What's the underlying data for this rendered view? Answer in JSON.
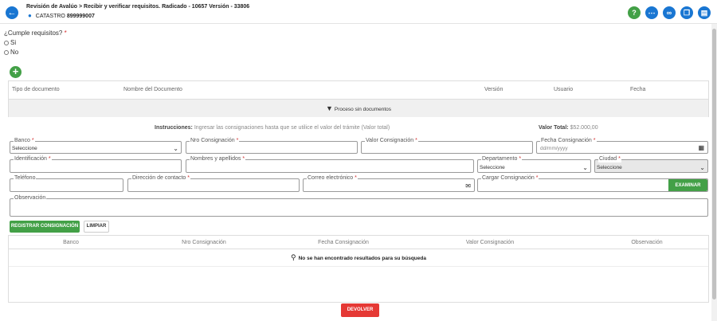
{
  "header": {
    "breadcrumb": "Revisión de Avalúo  >  Recibir y verificar requisitos. Radicado - 10657 Versión - 33806",
    "catastro_label": "CATASTRO",
    "catastro_value": "899999007"
  },
  "requisitos": {
    "question": "¿Cumple requisitos?",
    "options": [
      "Si",
      "No"
    ]
  },
  "doc_table": {
    "columns": [
      "Tipo de documento",
      "Nombre del Documento",
      "Versión",
      "Usuario",
      "Fecha"
    ],
    "empty_message": "Proceso sin documentos"
  },
  "instructions": {
    "label": "Instrucciones:",
    "text": "Ingresar las consignaciones hasta que se utilice el valor del trámite (Valor total)"
  },
  "valor_total": {
    "label": "Valor Total:",
    "value": "$52.000,00"
  },
  "form": {
    "banco": {
      "label": "Banco",
      "value": "Seleccione"
    },
    "nro_consignacion": {
      "label": "Nro Consignación",
      "value": ""
    },
    "valor_consignacion": {
      "label": "Valor Consignación",
      "value": ""
    },
    "fecha_consignacion": {
      "label": "Fecha Consignación",
      "placeholder": "dd/mm/yyyy"
    },
    "identificacion": {
      "label": "Identificación",
      "value": ""
    },
    "nombres": {
      "label": "Nombres y apellidos",
      "value": ""
    },
    "departamento": {
      "label": "Departamento",
      "value": "Seleccione"
    },
    "ciudad": {
      "label": "Ciudad",
      "value": "Seleccione"
    },
    "telefono": {
      "label": "Teléfono",
      "value": ""
    },
    "direccion": {
      "label": "Dirección de contacto",
      "value": ""
    },
    "correo": {
      "label": "Correo electrónico",
      "value": ""
    },
    "cargar": {
      "label": "Cargar Consignación",
      "button": "EXAMINAR"
    },
    "observacion": {
      "label": "Observación",
      "value": ""
    },
    "required_mark": "*"
  },
  "actions": {
    "registrar": "REGISTRAR CONSIGNACIÓN",
    "limpiar": "LIMPIAR",
    "devolver": "DEVOLVER"
  },
  "cons_table": {
    "columns": [
      "Banco",
      "Nro Consignación",
      "Fecha Consignación",
      "Valor Consignación",
      "Observación"
    ],
    "empty_message": "No se han encontrado resultados para su búsqueda"
  },
  "colors": {
    "primary": "#1976d2",
    "success": "#43a047",
    "danger": "#e53935"
  },
  "icons": {
    "back": "arrow-left-icon",
    "help": "question-icon",
    "more": "ellipsis-icon",
    "attach": "paperclip-icon",
    "copy": "copy-icon",
    "comment": "comment-icon"
  }
}
